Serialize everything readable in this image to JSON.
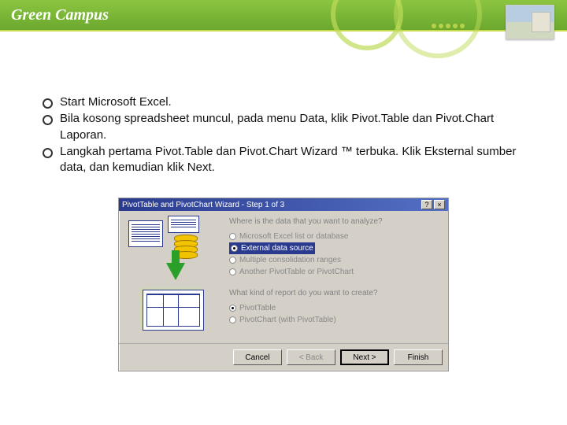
{
  "header": {
    "title": "Green Campus"
  },
  "bullets": [
    "Start Microsoft Excel.",
    "Bila kosong spreadsheet muncul, pada menu Data, klik Pivot.Table dan Pivot.Chart Laporan.",
    "Langkah pertama Pivot.Table dan Pivot.Chart Wizard ™ terbuka. Klik Eksternal sumber data, dan kemudian klik Next."
  ],
  "wizard": {
    "title": "PivotTable and PivotChart Wizard - Step 1 of 3",
    "question1": "Where is the data that you want to analyze?",
    "opts1": [
      "Microsoft Excel list or database",
      "External data source",
      "Multiple consolidation ranges",
      "Another PivotTable or PivotChart"
    ],
    "question2": "What kind of report do you want to create?",
    "opts2": [
      "PivotTable",
      "PivotChart (with PivotTable)"
    ],
    "buttons": {
      "cancel": "Cancel",
      "back": "< Back",
      "next": "Next >",
      "finish": "Finish"
    },
    "titleControls": {
      "help": "?",
      "close": "×"
    }
  }
}
